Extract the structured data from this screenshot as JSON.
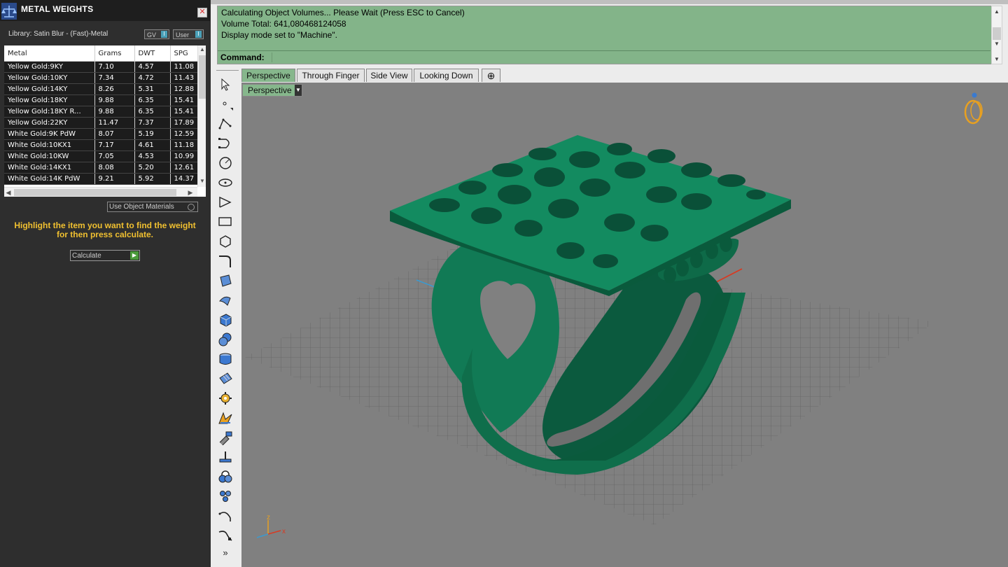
{
  "panel": {
    "title": "METAL WEIGHTS",
    "close_icon": "close-icon",
    "library_label": "Library: Satin Blur - (Fast)-Metal",
    "toggle_gv": "GV",
    "toggle_user": "User",
    "toggle_knob": "I",
    "columns": [
      "Metal",
      "Grams",
      "DWT",
      "SPG"
    ],
    "rows": [
      {
        "metal": "Yellow Gold:9KY",
        "grams": "7.10",
        "dwt": "4.57",
        "spg": "11.08"
      },
      {
        "metal": "Yellow Gold:10KY",
        "grams": "7.34",
        "dwt": "4.72",
        "spg": "11.43"
      },
      {
        "metal": "Yellow Gold:14KY",
        "grams": "8.26",
        "dwt": "5.31",
        "spg": "12.88"
      },
      {
        "metal": "Yellow Gold:18KY",
        "grams": "9.88",
        "dwt": "6.35",
        "spg": "15.41"
      },
      {
        "metal": "Yellow Gold:18KY R...",
        "grams": "9.88",
        "dwt": "6.35",
        "spg": "15.41"
      },
      {
        "metal": "Yellow Gold:22KY",
        "grams": "11.47",
        "dwt": "7.37",
        "spg": "17.89"
      },
      {
        "metal": "White Gold:9K PdW",
        "grams": "8.07",
        "dwt": "5.19",
        "spg": "12.59"
      },
      {
        "metal": "White Gold:10KX1",
        "grams": "7.17",
        "dwt": "4.61",
        "spg": "11.18"
      },
      {
        "metal": "White Gold:10KW",
        "grams": "7.05",
        "dwt": "4.53",
        "spg": "10.99"
      },
      {
        "metal": "White Gold:14KX1",
        "grams": "8.08",
        "dwt": "5.20",
        "spg": "12.61"
      },
      {
        "metal": "White Gold:14K PdW",
        "grams": "9.21",
        "dwt": "5.92",
        "spg": "14.37"
      }
    ],
    "use_object_materials": "Use Object Materials",
    "hint_line1": "Highlight the item you want to find the weight",
    "hint_line2": "for then press calculate.",
    "calculate_label": "Calculate"
  },
  "command": {
    "lines": [
      "Calculating Object Volumes... Please Wait (Press ESC to Cancel)",
      "Volume Total: 641,080468124058",
      "Display mode set to \"Machine\"."
    ],
    "prompt_label": "Command:",
    "prompt_value": ""
  },
  "viewport": {
    "tabs": [
      "Perspective",
      "Through Finger",
      "Side View",
      "Looking Down"
    ],
    "active_tab": "Perspective",
    "add_tab_icon": "plus-icon",
    "view_dropdown": "Perspective",
    "axis_x": "x",
    "axis_z": "z",
    "background": "#808080",
    "model_color": "#107a55",
    "tab_active_color": "#86b78c"
  },
  "toolbar": {
    "icons": [
      "select-arrow-icon",
      "point-icon",
      "polyline-icon",
      "curve-icon",
      "circle-icon",
      "ellipse-icon",
      "arc-icon",
      "rectangle-icon",
      "polygon-icon",
      "fillet-curve-icon",
      "surface-icon",
      "extrude-icon",
      "box-icon",
      "sphere-icon",
      "cylinder-icon",
      "mesh-icon",
      "gear-icon",
      "explode-icon",
      "boolean-icon",
      "trim-icon",
      "group-icon",
      "array-icon",
      "bend-icon",
      "flow-icon"
    ],
    "more_label": "»"
  }
}
